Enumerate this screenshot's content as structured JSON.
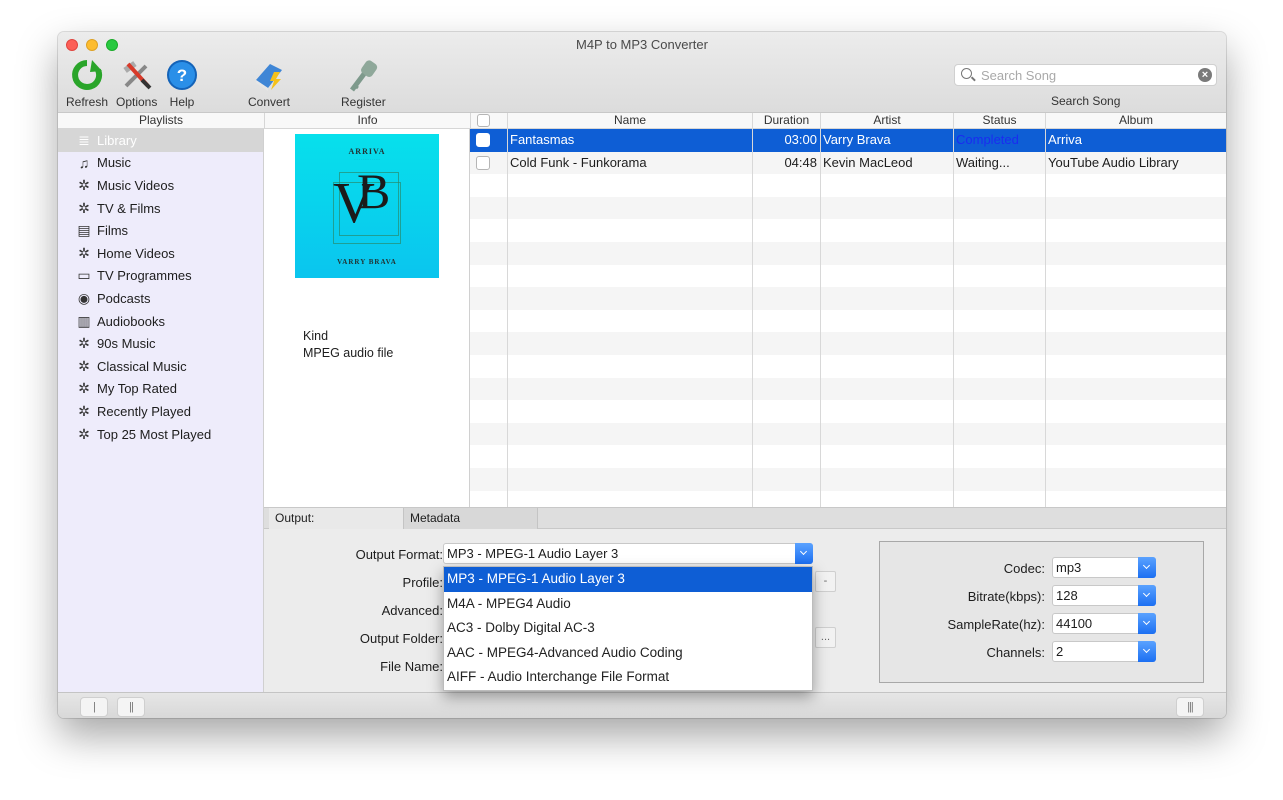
{
  "window": {
    "title": "M4P to MP3 Converter"
  },
  "toolbar": {
    "refresh": "Refresh",
    "options": "Options",
    "help": "Help",
    "convert": "Convert",
    "register": "Register",
    "search_placeholder": "Search Song",
    "search_value": "",
    "search_label": "Search Song"
  },
  "columns": {
    "playlists": "Playlists",
    "info": "Info",
    "name": "Name",
    "duration": "Duration",
    "artist": "Artist",
    "status": "Status",
    "album": "Album"
  },
  "sidebar": {
    "items": [
      {
        "label": "Library",
        "icon": "library-icon",
        "selected": true
      },
      {
        "label": "Music",
        "icon": "music-note-icon"
      },
      {
        "label": "Music Videos",
        "icon": "gear-icon"
      },
      {
        "label": "TV & Films",
        "icon": "gear-icon"
      },
      {
        "label": "Films",
        "icon": "film-icon"
      },
      {
        "label": "Home Videos",
        "icon": "gear-icon"
      },
      {
        "label": "TV Programmes",
        "icon": "tv-icon"
      },
      {
        "label": "Podcasts",
        "icon": "podcast-icon"
      },
      {
        "label": "Audiobooks",
        "icon": "book-icon"
      },
      {
        "label": "90s Music",
        "icon": "gear-icon"
      },
      {
        "label": "Classical Music",
        "icon": "gear-icon"
      },
      {
        "label": "My Top Rated",
        "icon": "gear-icon"
      },
      {
        "label": "Recently Played",
        "icon": "gear-icon"
      },
      {
        "label": "Top 25 Most Played",
        "icon": "gear-icon"
      }
    ]
  },
  "info": {
    "artwork": {
      "title": "ARRIVA",
      "artist": "VARRY BRAVA",
      "monogram_v": "V",
      "monogram_b": "B"
    },
    "kind_label": "Kind",
    "kind_value": "MPEG audio file"
  },
  "tracks": [
    {
      "name": "Fantasmas",
      "duration": "03:00",
      "artist": "Varry Brava",
      "status": "Completed",
      "album": "Arriva",
      "selected": true,
      "checked": false
    },
    {
      "name": "Cold Funk - Funkorama",
      "duration": "04:48",
      "artist": "Kevin MacLeod",
      "status": "Waiting...",
      "album": "YouTube Audio Library",
      "selected": false,
      "checked": false
    }
  ],
  "tabs": {
    "output": "Output:",
    "metadata": "Metadata"
  },
  "output_settings": {
    "format_label": "Output Format:",
    "format_value": "MP3 - MPEG-1 Audio Layer 3",
    "profile_label": "Profile:",
    "advanced_label": "Advanced:",
    "folder_label": "Output Folder:",
    "filename_label": "File Name:",
    "browse_label": "...",
    "profile_btn_label": "-",
    "format_options": [
      "MP3 - MPEG-1 Audio Layer 3",
      "M4A - MPEG4 Audio",
      "AC3 - Dolby Digital AC-3",
      "AAC - MPEG4-Advanced Audio Coding",
      "AIFF - Audio Interchange File Format"
    ]
  },
  "audio_settings": {
    "codec_label": "Codec:",
    "codec_value": "mp3",
    "bitrate_label": "Bitrate(kbps):",
    "bitrate_value": "128",
    "samplerate_label": "SampleRate(hz):",
    "samplerate_value": "44100",
    "channels_label": "Channels:",
    "channels_value": "2"
  },
  "statusbar": {
    "btn1": "|",
    "btn2": "||",
    "btn3": "|||"
  },
  "colors": {
    "selection": "#0e5ed5",
    "completed_status": "#1a2cf0"
  }
}
